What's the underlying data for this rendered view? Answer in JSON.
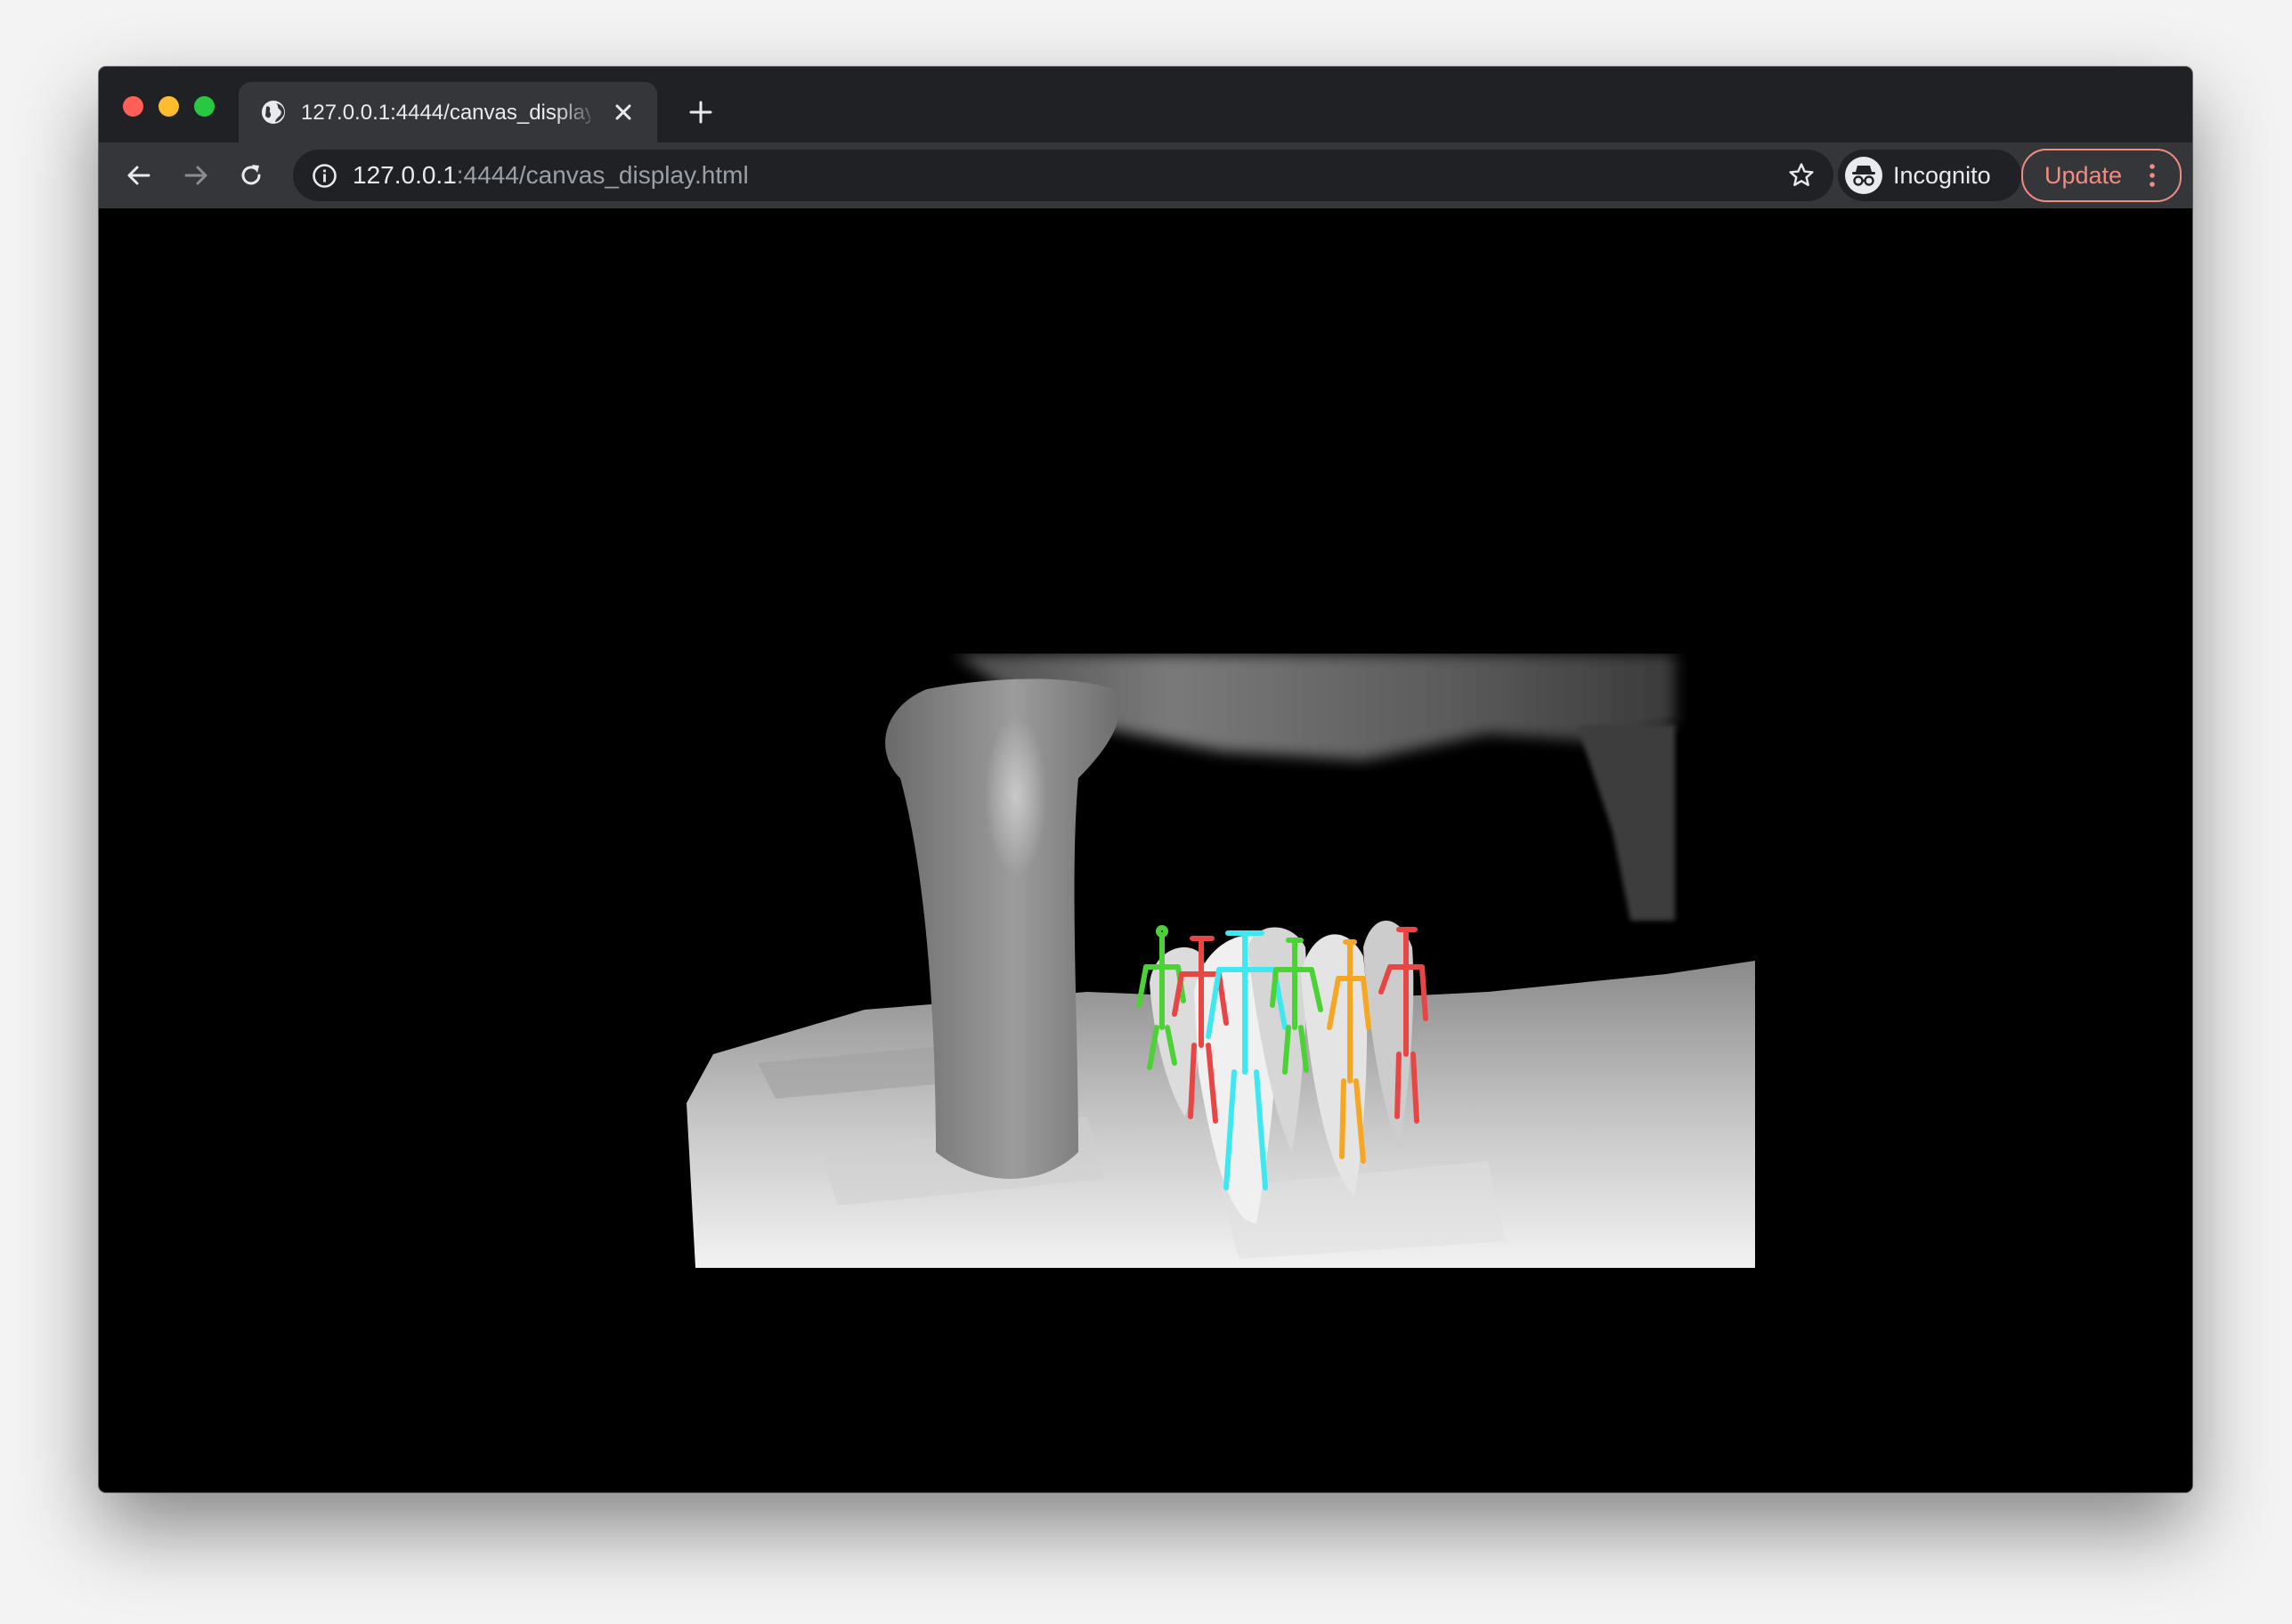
{
  "browser": {
    "tab": {
      "title": "127.0.0.1:4444/canvas_display.html",
      "icon": "globe-icon"
    },
    "toolbar": {
      "url_host": "127.0.0.1",
      "url_rest": ":4444/canvas_display.html",
      "profile_label": "Incognito",
      "update_label": "Update"
    },
    "colors": {
      "titlebar": "#202124",
      "toolbar": "#35363a",
      "update_accent": "#f28b82"
    }
  },
  "page": {
    "canvas": {
      "content": "depth-image-with-skeletons",
      "skeleton_colors": [
        "#4cd137",
        "#e84545",
        "#3fe8f0",
        "#4cd137",
        "#f5a623",
        "#e84545"
      ]
    }
  }
}
